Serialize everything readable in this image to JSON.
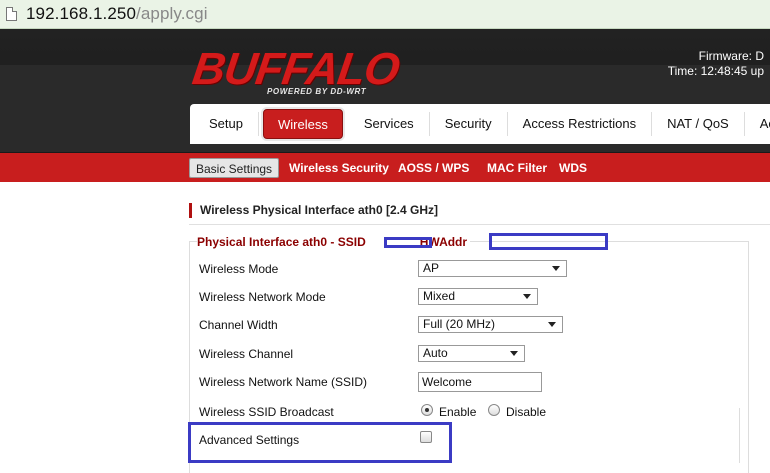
{
  "browser": {
    "url_host": "192.168.1.250",
    "url_path": "/apply.cgi"
  },
  "header": {
    "logo_text": "BUFFALO",
    "powered_by": "POWERED BY DD-WRT",
    "firmware_label": "Firmware: D",
    "time_label": "Time: 12:48:45 up"
  },
  "tabs": [
    {
      "label": "Setup"
    },
    {
      "label": "Wireless",
      "active": true
    },
    {
      "label": "Services"
    },
    {
      "label": "Security"
    },
    {
      "label": "Access Restrictions"
    },
    {
      "label": "NAT / QoS"
    },
    {
      "label": "Ac"
    }
  ],
  "subtabs": [
    {
      "label": "Basic Settings",
      "active": true
    },
    {
      "label": "Wireless Security"
    },
    {
      "label": "AOSS / WPS"
    },
    {
      "label": "MAC Filter"
    },
    {
      "label": "WDS"
    }
  ],
  "section": {
    "title": "Wireless Physical Interface ath0 [2.4 GHz]",
    "legend_prefix": "Physical Interface ath0 - SSID",
    "legend_hwaddr": "HWAddr"
  },
  "form": {
    "wireless_mode": {
      "label": "Wireless Mode",
      "value": "AP"
    },
    "network_mode": {
      "label": "Wireless Network Mode",
      "value": "Mixed"
    },
    "channel_width": {
      "label": "Channel Width",
      "value": "Full (20 MHz)"
    },
    "channel": {
      "label": "Wireless Channel",
      "value": "Auto"
    },
    "ssid": {
      "label": "Wireless Network Name (SSID)",
      "value": "Welcome"
    },
    "ssid_broadcast": {
      "label": "Wireless SSID Broadcast",
      "enable": "Enable",
      "disable": "Disable",
      "selected": "Enable"
    },
    "advanced": {
      "label": "Advanced Settings",
      "checked": false
    }
  },
  "colors": {
    "brand_red": "#c81e1e",
    "redaction_blue": "#3b3bc4",
    "legend_red": "#8b0000"
  }
}
